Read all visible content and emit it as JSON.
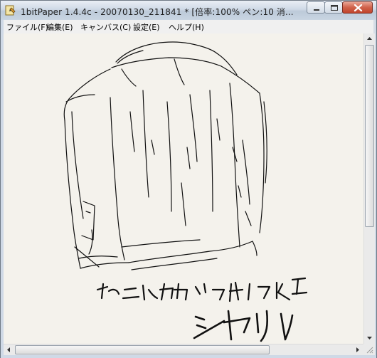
{
  "window": {
    "title": "1bitPaper 1.4.4c - 20070130_211841 *  [倍率:100%  ペン:10  消...",
    "app_icon": "paper-edit-icon"
  },
  "menu": [
    {
      "label": "ファイル(F)"
    },
    {
      "label": "編集(E)"
    },
    {
      "label": "キャンバス(C)"
    },
    {
      "label": "設定(E)"
    },
    {
      "label": "ヘルプ(H)"
    }
  ],
  "canvas": {
    "background": "#f4f2ec",
    "ink": "#111111",
    "caption_line1": "そこにかかってた",
    "caption_line2": "シャツ"
  },
  "colors": {
    "title_gradient_top": "#e9eef5",
    "close_button": "#c0452d"
  }
}
